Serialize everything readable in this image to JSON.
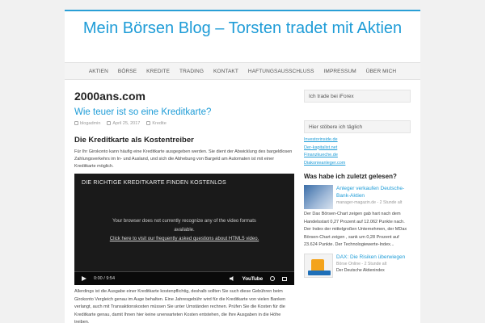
{
  "header": {
    "title": "Mein Börsen Blog – Torsten tradet mit Aktien"
  },
  "nav": [
    "AKTIEN",
    "BÖRSE",
    "KREDITE",
    "TRADING",
    "KONTAKT",
    "HAFTUNGSAUSSCHLUSS",
    "IMPRESSUM",
    "ÜBER MICH"
  ],
  "main": {
    "section_title": "2000ans.com",
    "post_title": "Wie teuer ist so eine Kreditkarte?",
    "meta": {
      "author": "blogadmin",
      "date": "April 25, 2017",
      "category": "Kredite"
    },
    "entry_heading": "Die Kreditkarte als Kostentreiber",
    "paragraph1": "Für Ihr Girokonto kann häufig eine Kreditkarte ausgegeben werden. Sie dient der Abwicklung des bargeldlosen Zahlungsverkehrs im In- und Ausland, und sich die Abhebung von Bargeld am Automaten ist mit einer Kreditkarte möglich.",
    "video": {
      "title": "DIE RICHTIGE KREDITKARTE FINDEN KOSTENLOS",
      "message_line1": "Your browser does not currently recognize any of the video formats",
      "message_line2": "available.",
      "message_link": "Click here to visit our frequently asked questions about HTML5 video.",
      "time_current": "0:00",
      "time_sep": "/",
      "time_total": "9:54",
      "brand": "YouTube"
    },
    "paragraph2": "Allerdings ist die Ausgabe einer Kreditkarte kostenpflichtig, deshalb sollten Sie such diese Gebühren beim Girokonto Vergleich genau im Auge behalten. Eine Jahresgebühr wird für die Kreditkarte von vielen Banken verlangt, auch mit Transaktionskosten müssen Sie unter Umständen rechnen. Prüfen Sie die Kosten für die Kreditkarte genau, damit Ihnen hier keine unerwarteten Kosten entstehen, die Ihre Ausgaben in die Höhe treiben."
  },
  "sidebar": {
    "widget1": "Ich trade bei iForex",
    "widget2": "Hier stöbere ich täglich",
    "links": [
      "Investorinside.de",
      "Der-kapitalist.net",
      "Finanzkueche.de",
      "Diakonieanleger.com"
    ],
    "recent_heading": "Was habe ich zuletzt gelesen?",
    "articles": [
      {
        "title": "Anleger verkaufen Deutsche-Bank-Aktien",
        "source": "manager-magazin.de - 2 Stunde alt",
        "text": "Der Dax Börsen-Chart zeigen gab hart nach dem Handelsstart 0,27 Prozent auf 12.062 Punkte nach. Der Index der mittelgroßen Unternehmen, der MDax Börsen-Chart zeigen , sank um 0,28 Prozent auf 23.624 Punkte. Der Technologiewerte-Index..."
      },
      {
        "title": "DAX: Die Risiken überwiegen",
        "source": "Börse Online - 2 Stunde alt",
        "text": "Der Deutsche Aktienindex"
      }
    ]
  },
  "colors": {
    "accent": "#1e9cd7",
    "top_border": "#2a9fd6"
  }
}
